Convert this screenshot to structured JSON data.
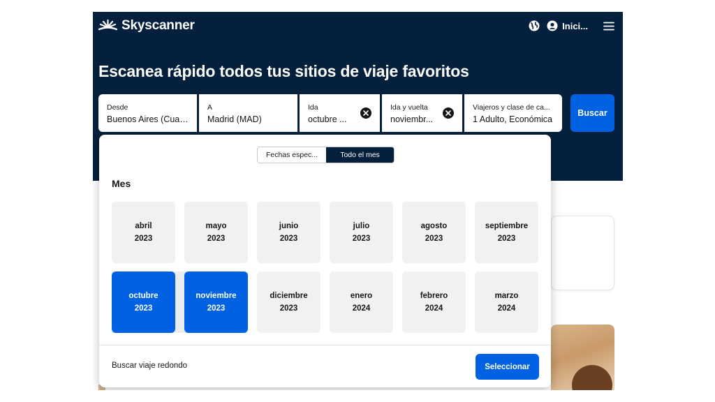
{
  "header": {
    "logo_text": "Skyscanner",
    "login_label": "Inici..."
  },
  "hero": {
    "headline": "Escanea rápido todos tus sitios de viaje favoritos"
  },
  "search": {
    "from": {
      "label": "Desde",
      "value": "Buenos Aires (Cualq..."
    },
    "to": {
      "label": "A",
      "value": "Madrid (MAD)"
    },
    "depart": {
      "label": "Ida",
      "value": "octubre ..."
    },
    "return": {
      "label": "Ida y vuelta",
      "value": "noviembr..."
    },
    "travellers": {
      "label": "Viajeros y clase de ca...",
      "value": "1 Adulto, Económica"
    },
    "search_button": "Buscar"
  },
  "popup": {
    "tabs": [
      "Fechas espec...",
      "Todo el mes"
    ],
    "active_tab": "Todo el mes",
    "section_title": "Mes",
    "months": [
      {
        "name": "abril",
        "year": "2023",
        "selected": false
      },
      {
        "name": "mayo",
        "year": "2023",
        "selected": false
      },
      {
        "name": "junio",
        "year": "2023",
        "selected": false
      },
      {
        "name": "julio",
        "year": "2023",
        "selected": false
      },
      {
        "name": "agosto",
        "year": "2023",
        "selected": false
      },
      {
        "name": "septiembre",
        "year": "2023",
        "selected": false
      },
      {
        "name": "octubre",
        "year": "2023",
        "selected": true
      },
      {
        "name": "noviembre",
        "year": "2023",
        "selected": true
      },
      {
        "name": "diciembre",
        "year": "2023",
        "selected": false
      },
      {
        "name": "enero",
        "year": "2024",
        "selected": false
      },
      {
        "name": "febrero",
        "year": "2024",
        "selected": false
      },
      {
        "name": "marzo",
        "year": "2024",
        "selected": false
      }
    ],
    "footer_text": "Buscar viaje redondo",
    "select_button": "Seleccionar"
  },
  "colors": {
    "hero_background": "#05203c",
    "accent_blue": "#0062e3",
    "month_tile": "#eff1f2"
  },
  "icons": [
    "skyscanner-logo-icon",
    "globe-icon",
    "account-icon",
    "menu-icon",
    "clear-icon"
  ]
}
